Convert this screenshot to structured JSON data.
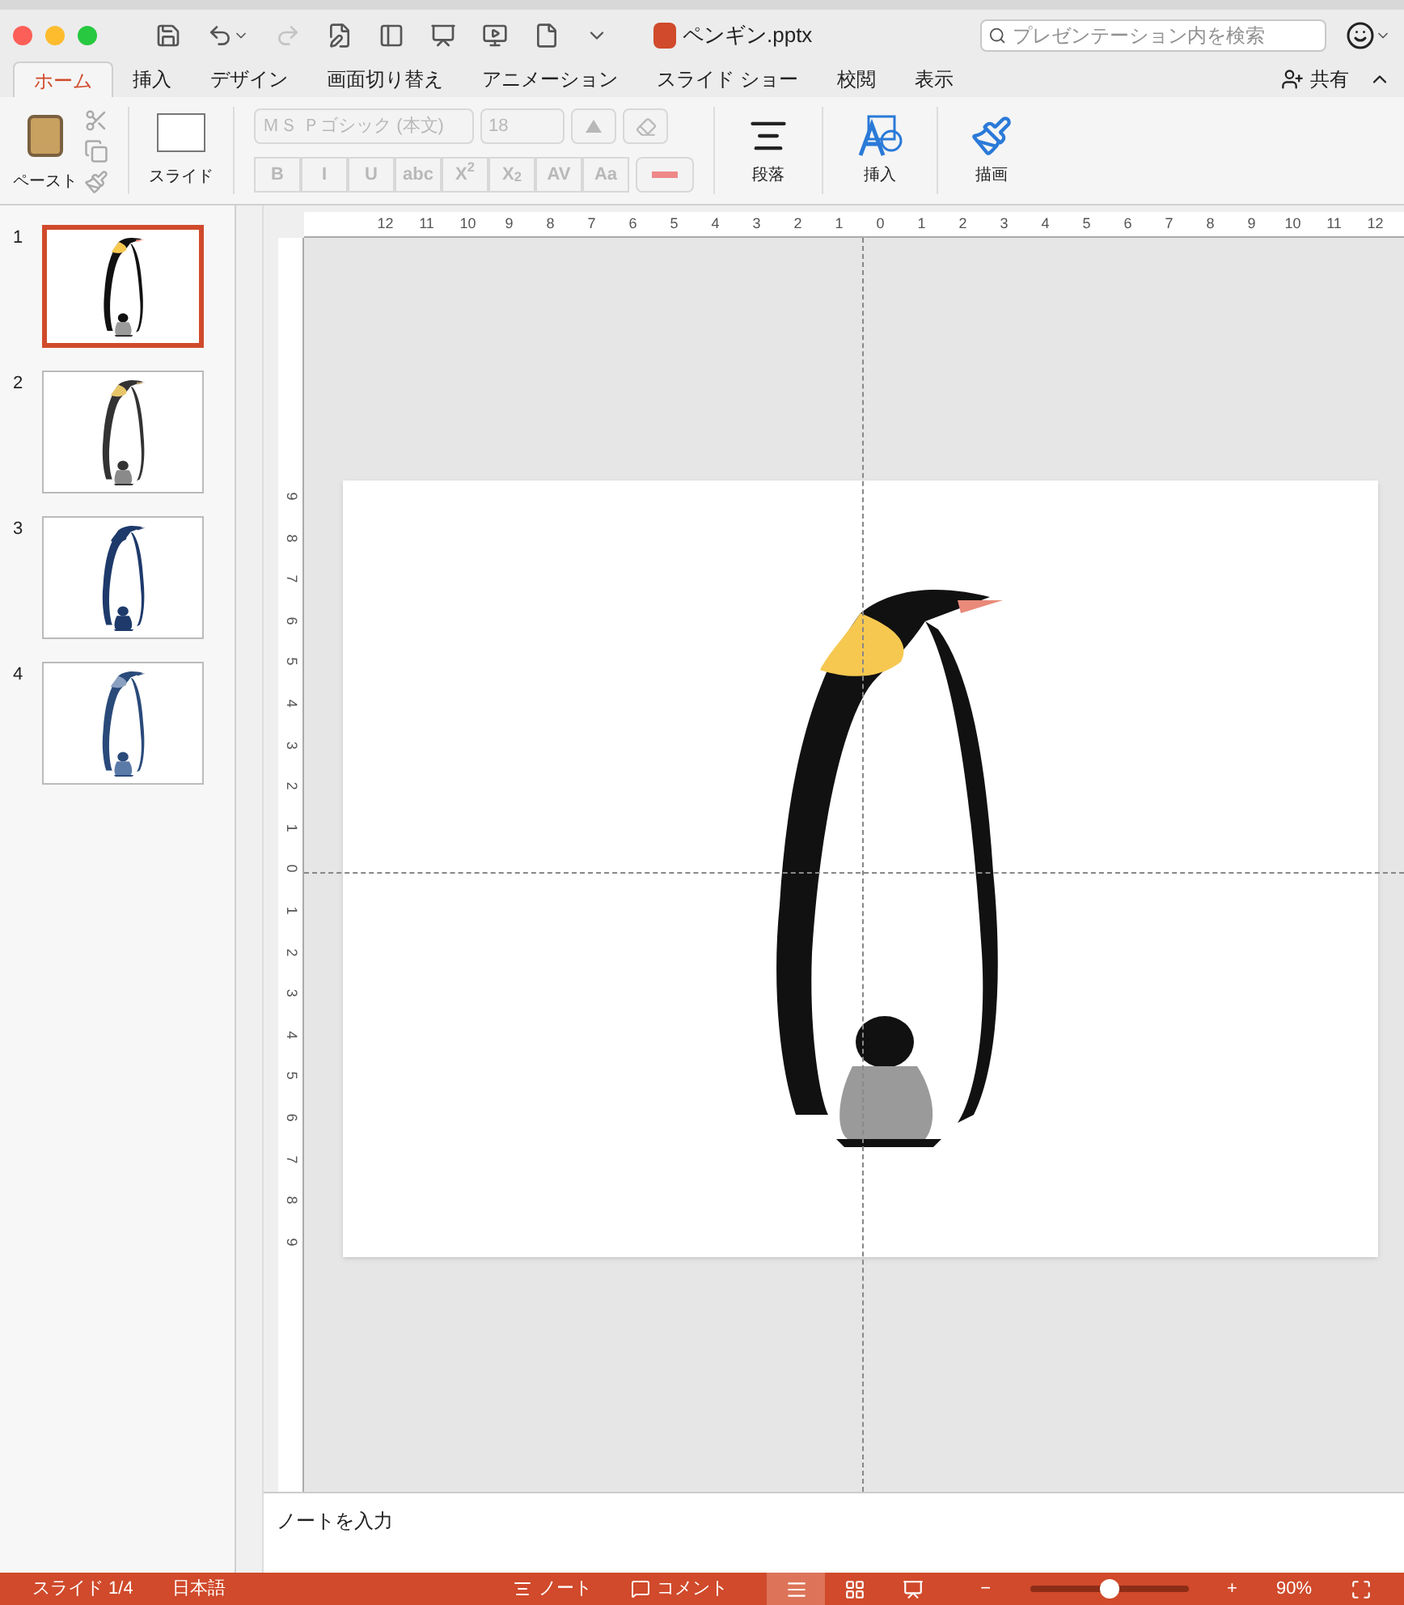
{
  "window": {
    "file_name": "ペンギン.pptx"
  },
  "search": {
    "placeholder": "プレゼンテーション内を検索"
  },
  "tabs": [
    {
      "label": "ホーム",
      "selected": true
    },
    {
      "label": "挿入",
      "selected": false
    },
    {
      "label": "デザイン",
      "selected": false
    },
    {
      "label": "画面切り替え",
      "selected": false
    },
    {
      "label": "アニメーション",
      "selected": false
    },
    {
      "label": "スライド ショー",
      "selected": false
    },
    {
      "label": "校閲",
      "selected": false
    },
    {
      "label": "表示",
      "selected": false
    }
  ],
  "share": {
    "label": "共有"
  },
  "ribbon": {
    "paste": "ペースト",
    "slide": "スライド",
    "font": {
      "name": "ＭＳ Ｐゴシック (本文)",
      "size": "18",
      "disabled": true,
      "format_buttons": [
        "B",
        "I",
        "U",
        "abc",
        "X$^{2}$",
        "X$_{2}$",
        "AV",
        "Aa"
      ]
    },
    "paragraph": "段落",
    "insert": "挿入",
    "draw": "描画"
  },
  "rulers": {
    "horizontal": [
      "12",
      "11",
      "10",
      "9",
      "8",
      "7",
      "6",
      "5",
      "4",
      "3",
      "2",
      "1",
      "0",
      "1",
      "2",
      "3",
      "4",
      "5",
      "6",
      "7",
      "8",
      "9",
      "10",
      "11",
      "12"
    ],
    "vertical": [
      "9",
      "8",
      "7",
      "6",
      "5",
      "4",
      "3",
      "2",
      "1",
      "0",
      "1",
      "2",
      "3",
      "4",
      "5",
      "6",
      "7",
      "8",
      "9"
    ]
  },
  "slides": [
    {
      "number": "1",
      "selected": true,
      "kind": "color"
    },
    {
      "number": "2",
      "selected": false,
      "kind": "gray"
    },
    {
      "number": "3",
      "selected": false,
      "kind": "navy"
    },
    {
      "number": "4",
      "selected": false,
      "kind": "outline"
    }
  ],
  "notes": {
    "placeholder": "ノートを入力"
  },
  "status_bar": {
    "slide": "スライド 1/4",
    "language": "日本語",
    "notes": "ノート",
    "comments": "コメント",
    "views": [
      {
        "kind": "normal",
        "selected": true
      },
      {
        "kind": "sorter",
        "selected": false
      },
      {
        "kind": "reading",
        "selected": false
      }
    ],
    "zoom": {
      "minus": "−",
      "plus": "+",
      "level": 0.5,
      "reading": "90%"
    }
  }
}
